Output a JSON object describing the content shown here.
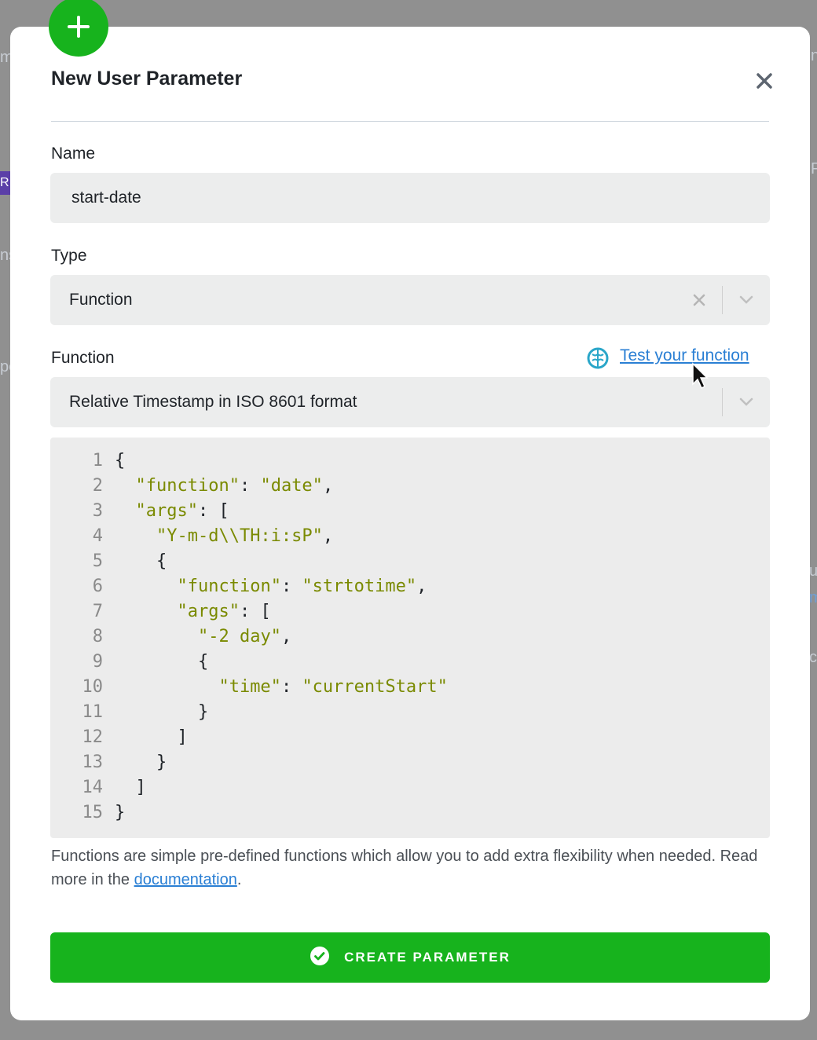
{
  "background": {
    "fragments": [
      "m",
      "R",
      "ns",
      "pe",
      "P",
      "ns",
      "ue",
      "m",
      "ce"
    ]
  },
  "modal": {
    "title": "New User Parameter",
    "icons": {
      "add": "plus-icon",
      "close": "close-icon"
    }
  },
  "form": {
    "name": {
      "label": "Name",
      "value": "start-date"
    },
    "type": {
      "label": "Type",
      "value": "Function"
    },
    "function": {
      "label": "Function",
      "value": "Relative Timestamp in ISO 8601 format",
      "test_link": "Test your function",
      "test_icon": "brain-icon"
    }
  },
  "code": {
    "lines": [
      {
        "n": "1",
        "indent": "",
        "parts": [
          [
            "p",
            "{"
          ]
        ]
      },
      {
        "n": "2",
        "indent": "  ",
        "parts": [
          [
            "s",
            "\"function\""
          ],
          [
            "p",
            ": "
          ],
          [
            "s",
            "\"date\""
          ],
          [
            "p",
            ","
          ]
        ]
      },
      {
        "n": "3",
        "indent": "  ",
        "parts": [
          [
            "s",
            "\"args\""
          ],
          [
            "p",
            ": ["
          ]
        ]
      },
      {
        "n": "4",
        "indent": "    ",
        "parts": [
          [
            "s",
            "\"Y-m-d\\\\TH:i:sP\""
          ],
          [
            "p",
            ","
          ]
        ]
      },
      {
        "n": "5",
        "indent": "    ",
        "parts": [
          [
            "p",
            "{"
          ]
        ]
      },
      {
        "n": "6",
        "indent": "      ",
        "parts": [
          [
            "s",
            "\"function\""
          ],
          [
            "p",
            ": "
          ],
          [
            "s",
            "\"strtotime\""
          ],
          [
            "p",
            ","
          ]
        ]
      },
      {
        "n": "7",
        "indent": "      ",
        "parts": [
          [
            "s",
            "\"args\""
          ],
          [
            "p",
            ": ["
          ]
        ]
      },
      {
        "n": "8",
        "indent": "        ",
        "parts": [
          [
            "s",
            "\"-2 day\""
          ],
          [
            "p",
            ","
          ]
        ]
      },
      {
        "n": "9",
        "indent": "        ",
        "parts": [
          [
            "p",
            "{"
          ]
        ]
      },
      {
        "n": "10",
        "indent": "          ",
        "parts": [
          [
            "s",
            "\"time\""
          ],
          [
            "p",
            ": "
          ],
          [
            "s",
            "\"currentStart\""
          ]
        ]
      },
      {
        "n": "11",
        "indent": "        ",
        "parts": [
          [
            "p",
            "}"
          ]
        ]
      },
      {
        "n": "12",
        "indent": "      ",
        "parts": [
          [
            "p",
            "]"
          ]
        ]
      },
      {
        "n": "13",
        "indent": "    ",
        "parts": [
          [
            "p",
            "}"
          ]
        ]
      },
      {
        "n": "14",
        "indent": "  ",
        "parts": [
          [
            "p",
            "]"
          ]
        ]
      },
      {
        "n": "15",
        "indent": "",
        "parts": [
          [
            "p",
            "}"
          ]
        ]
      }
    ]
  },
  "help": {
    "text_before": "Functions are simple pre-defined functions which allow you to add extra flexibility when needed. Read more in the ",
    "link": "documentation",
    "text_after": "."
  },
  "submit": {
    "label": "CREATE PARAMETER",
    "icon": "check-circle-icon"
  },
  "colors": {
    "accent_green": "#17b31d",
    "link_blue": "#2a7fd4",
    "code_string": "#7a8a00"
  }
}
